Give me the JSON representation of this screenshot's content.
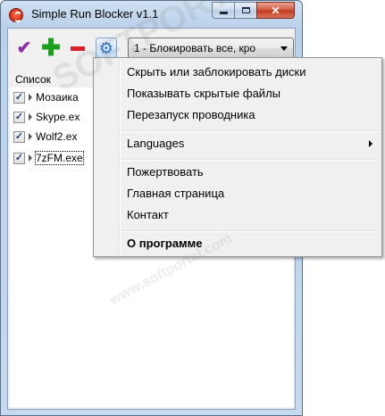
{
  "window": {
    "title": "Simple Run Blocker v1.1",
    "close_glyph": "✕"
  },
  "toolbar": {
    "buttons": [
      {
        "icon": "check-icon",
        "glyph": "✔"
      },
      {
        "icon": "plus-icon",
        "glyph": "✚"
      },
      {
        "icon": "minus-icon",
        "glyph": ""
      },
      {
        "icon": "gear-icon",
        "glyph": "⚙"
      }
    ],
    "mode_select_value": "1 - Блокировать все, кро"
  },
  "list": {
    "label": "Список",
    "items": [
      {
        "name": "Мозаика",
        "checked": true
      },
      {
        "name": "Skype.ex",
        "checked": true
      },
      {
        "name": "Wolf2.ex",
        "checked": true
      },
      {
        "name": "7zFM.exe",
        "checked": true
      }
    ],
    "check_glyph": "✓"
  },
  "context_menu": {
    "items": [
      "Скрыть или заблокировать диски",
      "Показывать скрытые файлы",
      "Перезапуск проводника",
      "Languages",
      "Пожертвовать",
      "Главная страница",
      "Контакт",
      "О программе"
    ]
  },
  "watermark": {
    "text1": "SOFTPORTAL",
    "text2": "www.softportal.com"
  },
  "colors": {
    "accent_check": "#8a2ea8",
    "accent_plus": "#1aa01a",
    "accent_minus": "#d8202a",
    "close_button": "#c23a1e"
  }
}
